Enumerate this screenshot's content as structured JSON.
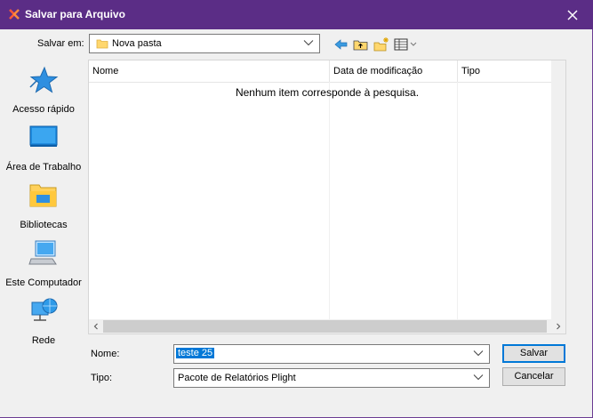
{
  "window": {
    "title": "Salvar para Arquivo"
  },
  "top_bar": {
    "save_in_label": "Salvar em:",
    "save_in_value": "Nova pasta"
  },
  "places": [
    {
      "label": "Acesso rápido",
      "icon": "star-icon"
    },
    {
      "label": "Área de Trabalho",
      "icon": "desktop-icon"
    },
    {
      "label": "Bibliotecas",
      "icon": "libraries-icon"
    },
    {
      "label": "Este Computador",
      "icon": "computer-icon"
    },
    {
      "label": "Rede",
      "icon": "network-icon"
    }
  ],
  "file_list": {
    "columns": [
      "Nome",
      "Data de modificação",
      "Tipo"
    ],
    "empty_message": "Nenhum item corresponde à pesquisa."
  },
  "form": {
    "name_label": "Nome:",
    "name_value": "teste 25",
    "type_label": "Tipo:",
    "type_value": "Pacote de Relatórios Plight"
  },
  "buttons": {
    "save": "Salvar",
    "cancel": "Cancelar"
  },
  "colors": {
    "titlebar": "#5b2d86",
    "selection": "#0078d7"
  }
}
